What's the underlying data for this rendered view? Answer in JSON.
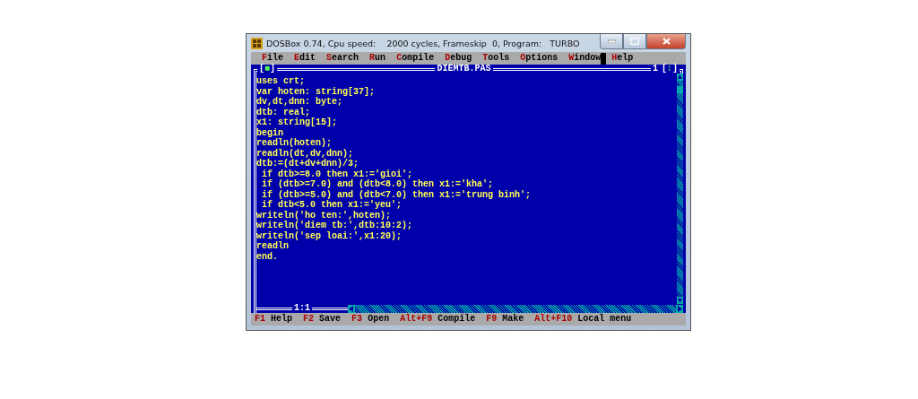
{
  "window": {
    "title": "DOSBox 0.74, Cpu speed:    2000 cycles, Frameskip  0, Program:   TURBO"
  },
  "menu": [
    {
      "label": "File"
    },
    {
      "label": "Edit"
    },
    {
      "label": "Search"
    },
    {
      "label": "Run"
    },
    {
      "label": "Compile"
    },
    {
      "label": "Debug"
    },
    {
      "label": "Tools"
    },
    {
      "label": "Options"
    },
    {
      "label": "Window"
    },
    {
      "label": "Help"
    }
  ],
  "editor": {
    "close_box": "[■]",
    "file_name": "DIEMTB.PAS",
    "window_number": "1",
    "zoom_box": "[↕]",
    "cursor_position": "1:1",
    "lines": [
      "uses crt;",
      "var hoten: string[37];",
      "dv,dt,dnn: byte;",
      "dtb: real;",
      "x1: string[15];",
      "begin",
      "readln(hoten);",
      "readln(dt,dv,dnn);",
      "dtb:=(dt+dv+dnn)/3;",
      " if dtb>=8.0 then x1:='gioi';",
      " if (dtb>=7.0) and (dtb<8.0) then x1:='kha';",
      " if (dtb>=5.0) and (dtb<7.0) then x1:='trung binh';",
      " if dtb<5.0 then x1:='yeu';",
      "writeln('ho ten:',hoten);",
      "writeln('diem tb:',dtb:10:2);",
      "writeln('sep loai:',x1:20);",
      "readln",
      "end."
    ]
  },
  "status_bar": [
    {
      "key": "F1",
      "label": "Help"
    },
    {
      "key": "F2",
      "label": "Save"
    },
    {
      "key": "F3",
      "label": "Open"
    },
    {
      "key": "Alt+F9",
      "label": "Compile"
    },
    {
      "key": "F9",
      "label": "Make"
    },
    {
      "key": "Alt+F10",
      "label": "Local menu"
    }
  ]
}
